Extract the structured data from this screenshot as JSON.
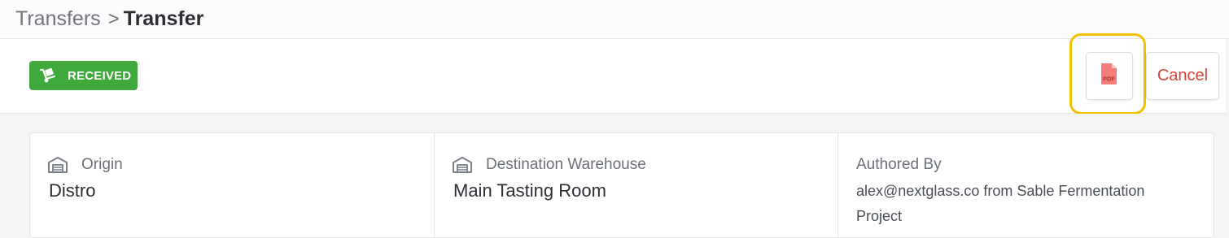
{
  "breadcrumb": {
    "parent": "Transfers",
    "separator": ">",
    "current": "Transfer"
  },
  "toolbar": {
    "status": "RECEIVED",
    "status_icon": "hand-truck-icon",
    "status_color": "#3fa93c",
    "pdf_label": "PDF",
    "pdf_icon": "pdf-file-icon",
    "cancel_label": "Cancel",
    "cancel_color": "#d8433b",
    "highlight_color": "#f2c200"
  },
  "details": {
    "origin": {
      "label": "Origin",
      "value": "Distro",
      "icon": "warehouse-icon"
    },
    "destination": {
      "label": "Destination Warehouse",
      "value": "Main Tasting Room",
      "icon": "warehouse-icon"
    },
    "authored_by": {
      "label": "Authored By",
      "value": "alex@nextglass.co from Sable Fermentation Project"
    }
  }
}
